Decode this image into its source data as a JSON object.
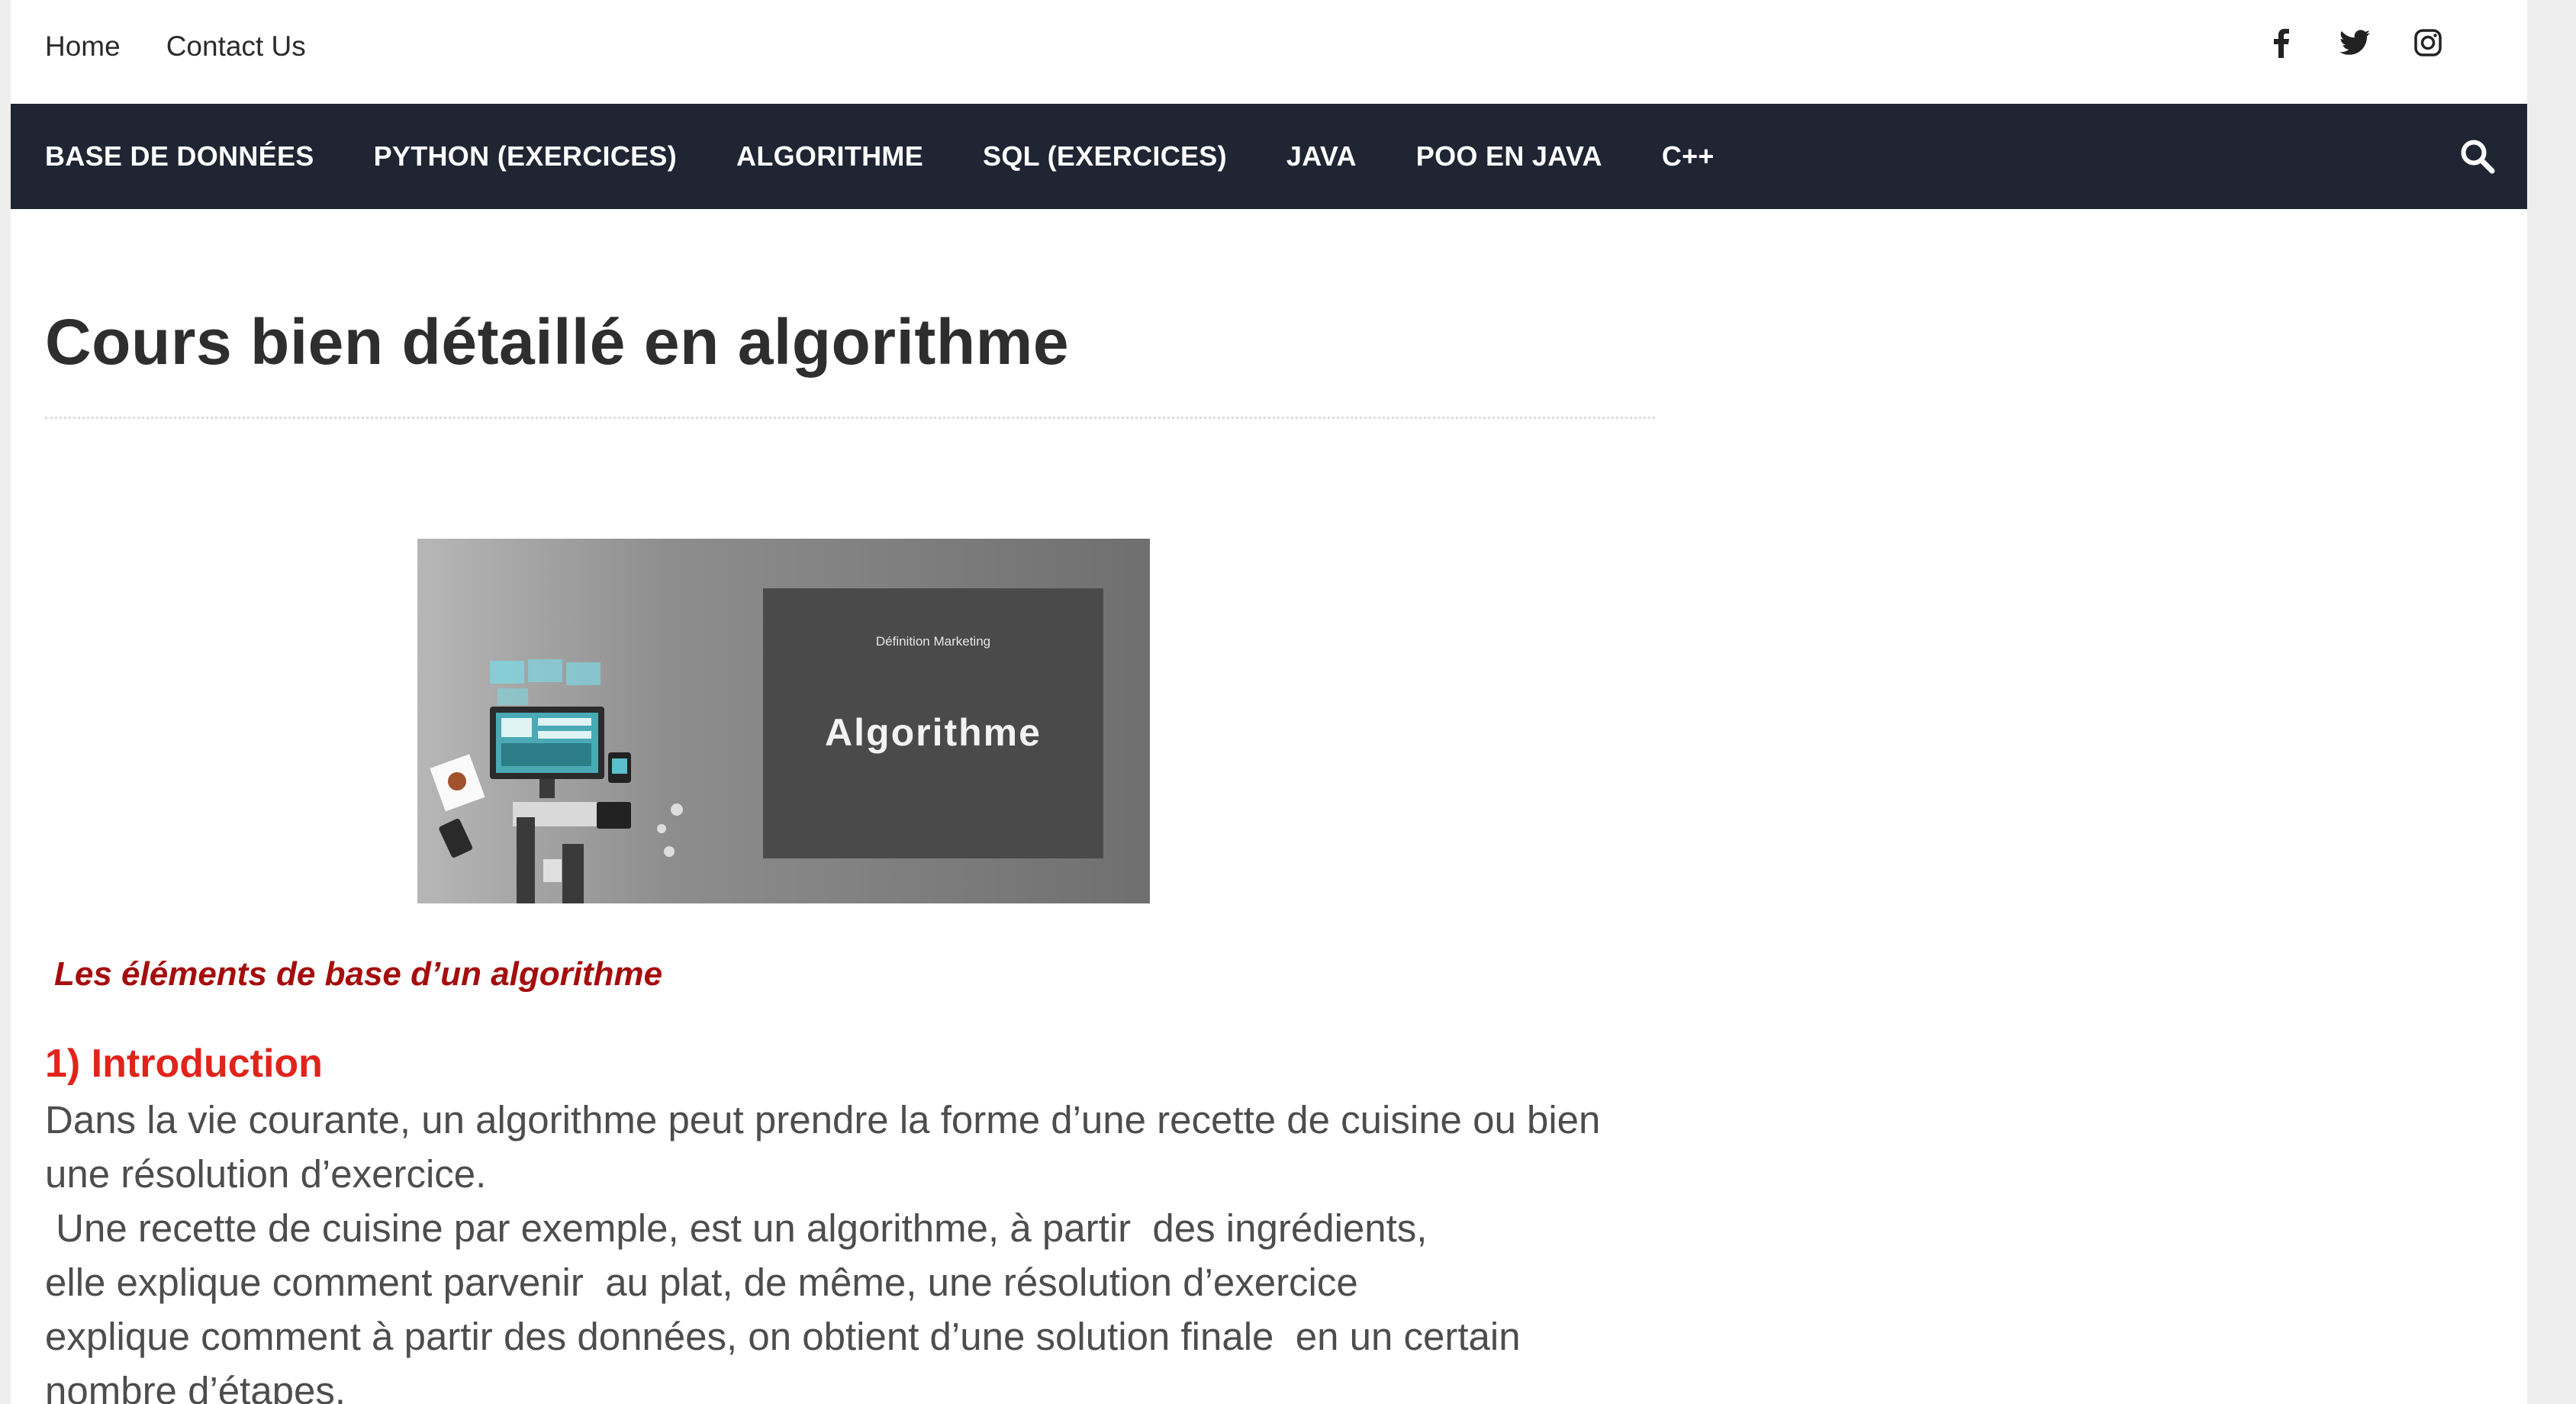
{
  "topbar": {
    "links": [
      "Home",
      "Contact Us"
    ],
    "social_icons": [
      "facebook-icon",
      "twitter-icon",
      "instagram-icon"
    ]
  },
  "nav": {
    "items": [
      "BASE DE DONNÉES",
      "PYTHON (EXERCICES)",
      "ALGORITHME",
      "SQL (EXERCICES)",
      "JAVA",
      "POO EN JAVA",
      "C++"
    ],
    "search_icon": "search-icon"
  },
  "article": {
    "title": "Cours bien détaillé en algorithme",
    "hero_image": {
      "small_text": "Définition Marketing",
      "big_text": "Algorithme"
    },
    "subtitle": "Les  éléments de base d’un algorithme",
    "intro_heading": "1) Introduction",
    "lines": [
      "Dans la vie courante, un algorithme peut prendre la forme d’une recette de cuisine ou bien",
      "une résolution d’exercice.",
      " Une recette de cuisine par exemple, est un algorithme, à partir  des ingrédients,",
      "elle explique comment parvenir  au plat, de même, une résolution d’exercice",
      "explique comment à partir des données, on obtient d’une solution finale  en un certain",
      "nombre d’étapes."
    ]
  },
  "colors": {
    "nav_background": "#1f2533",
    "subtitle": "#a50d0d",
    "heading_red": "#e0241b",
    "body_text": "#4d4d4d"
  }
}
